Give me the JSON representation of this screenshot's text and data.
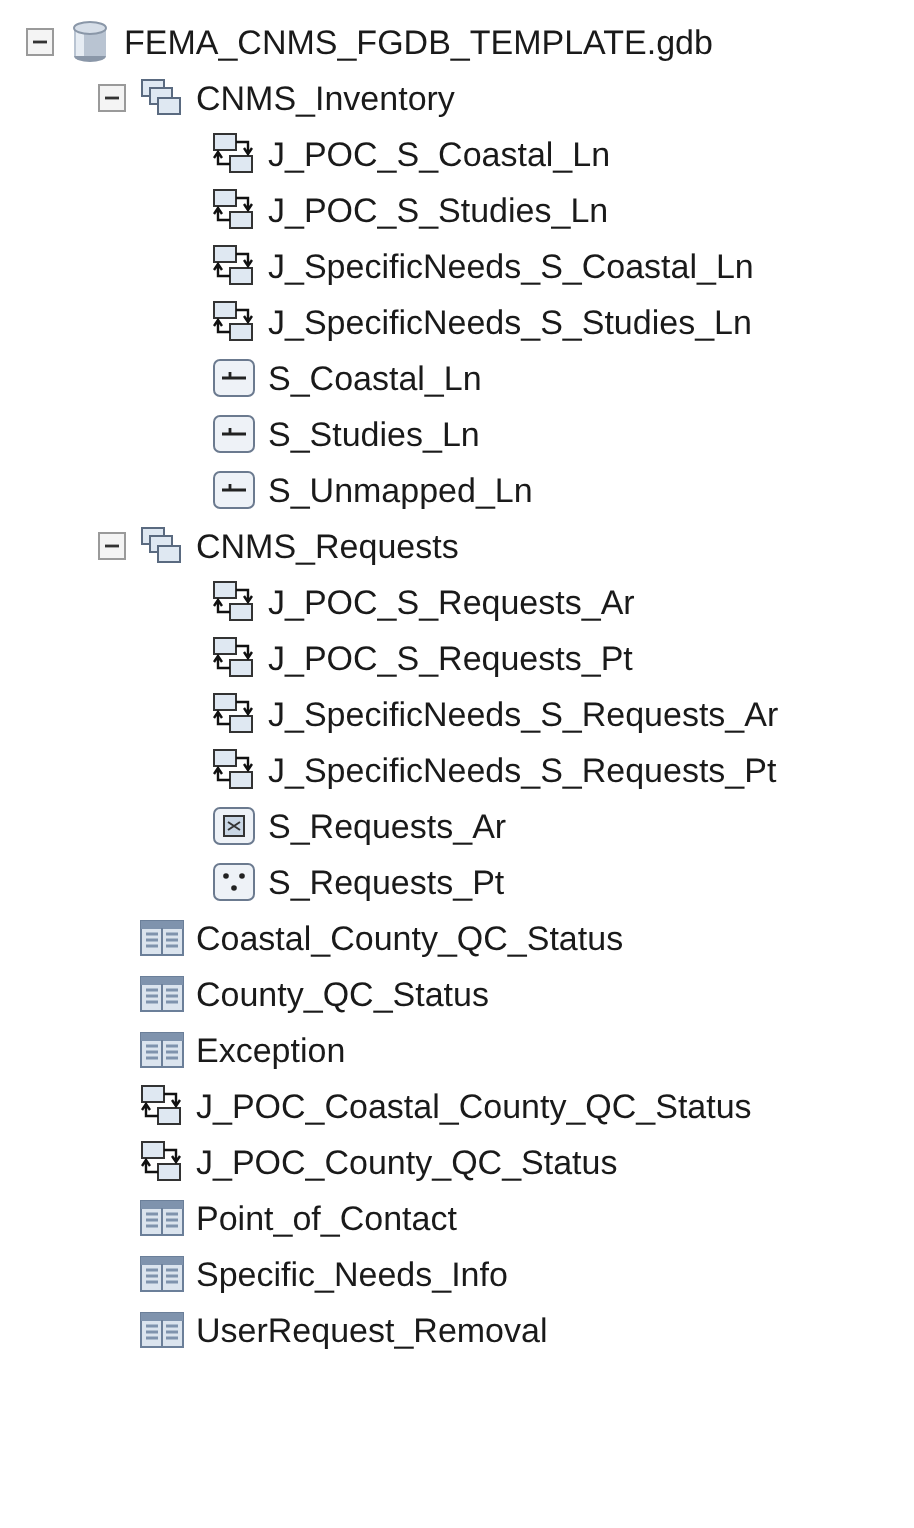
{
  "tree": [
    {
      "label": "FEMA_CNMS_FGDB_TEMPLATE.gdb",
      "kind": "database",
      "expanded": true,
      "children": [
        {
          "label": "CNMS_Inventory",
          "kind": "dataset",
          "expanded": true,
          "children": [
            {
              "label": "J_POC_S_Coastal_Ln",
              "kind": "relationship"
            },
            {
              "label": "J_POC_S_Studies_Ln",
              "kind": "relationship"
            },
            {
              "label": "J_SpecificNeeds_S_Coastal_Ln",
              "kind": "relationship"
            },
            {
              "label": "J_SpecificNeeds_S_Studies_Ln",
              "kind": "relationship"
            },
            {
              "label": "S_Coastal_Ln",
              "kind": "line"
            },
            {
              "label": "S_Studies_Ln",
              "kind": "line"
            },
            {
              "label": "S_Unmapped_Ln",
              "kind": "line"
            }
          ]
        },
        {
          "label": "CNMS_Requests",
          "kind": "dataset",
          "expanded": true,
          "children": [
            {
              "label": "J_POC_S_Requests_Ar",
              "kind": "relationship"
            },
            {
              "label": "J_POC_S_Requests_Pt",
              "kind": "relationship"
            },
            {
              "label": "J_SpecificNeeds_S_Requests_Ar",
              "kind": "relationship"
            },
            {
              "label": "J_SpecificNeeds_S_Requests_Pt",
              "kind": "relationship"
            },
            {
              "label": "S_Requests_Ar",
              "kind": "polygon"
            },
            {
              "label": "S_Requests_Pt",
              "kind": "point"
            }
          ]
        },
        {
          "label": "Coastal_County_QC_Status",
          "kind": "table"
        },
        {
          "label": "County_QC_Status",
          "kind": "table"
        },
        {
          "label": "Exception",
          "kind": "table"
        },
        {
          "label": "J_POC_Coastal_County_QC_Status",
          "kind": "relationship"
        },
        {
          "label": "J_POC_County_QC_Status",
          "kind": "relationship"
        },
        {
          "label": "Point_of_Contact",
          "kind": "table"
        },
        {
          "label": "Specific_Needs_Info",
          "kind": "table"
        },
        {
          "label": "UserRequest_Removal",
          "kind": "table"
        }
      ]
    }
  ]
}
